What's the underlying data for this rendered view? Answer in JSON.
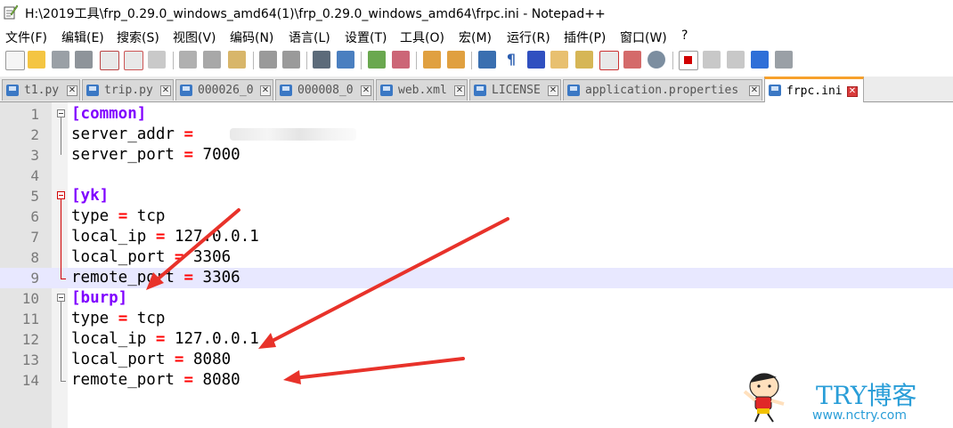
{
  "window": {
    "title": "H:\\2019工具\\frp_0.29.0_windows_amd64(1)\\frp_0.29.0_windows_amd64\\frpc.ini - Notepad++"
  },
  "menu": [
    "文件(F)",
    "编辑(E)",
    "搜索(S)",
    "视图(V)",
    "编码(N)",
    "语言(L)",
    "设置(T)",
    "工具(O)",
    "宏(M)",
    "运行(R)",
    "插件(P)",
    "窗口(W)",
    "?"
  ],
  "toolbar": {
    "icons": [
      "new-file-icon",
      "open-file-icon",
      "save-icon",
      "save-all-icon",
      "close-icon",
      "close-all-icon",
      "print-icon",
      "cut-icon",
      "copy-icon",
      "paste-icon",
      "undo-icon",
      "redo-icon",
      "find-icon",
      "replace-icon",
      "zoom-in-icon",
      "zoom-out-icon",
      "sync-vertical-icon",
      "sync-horizontal-icon",
      "word-wrap-icon",
      "show-all-chars-icon",
      "indent-guide-icon",
      "user-lang-icon",
      "doc-map-icon",
      "function-list-icon",
      "folder-workspace-icon",
      "monitor-icon",
      "record-macro-icon",
      "stop-record-icon",
      "play-macro-icon",
      "run-macro-multiple-icon",
      "save-macro-icon"
    ]
  },
  "tabs": [
    {
      "label": "t1.py",
      "active": false
    },
    {
      "label": "trip.py",
      "active": false
    },
    {
      "label": "000026_0",
      "active": false
    },
    {
      "label": "000008_0",
      "active": false
    },
    {
      "label": "web.xml",
      "active": false
    },
    {
      "label": "LICENSE",
      "active": false
    },
    {
      "label": "application.properties",
      "active": false
    },
    {
      "label": "frpc.ini",
      "active": true
    }
  ],
  "editor": {
    "current_line": 9,
    "lines": [
      {
        "n": "1",
        "key": "[common]",
        "eq": "",
        "val": ""
      },
      {
        "n": "2",
        "key": "server_addr",
        "eq": "=",
        "val": ""
      },
      {
        "n": "3",
        "key": "server_port",
        "eq": "=",
        "val": "7000"
      },
      {
        "n": "4",
        "key": "",
        "eq": "",
        "val": ""
      },
      {
        "n": "5",
        "key": "[yk]",
        "eq": "",
        "val": ""
      },
      {
        "n": "6",
        "key": "type",
        "eq": "=",
        "val": "tcp"
      },
      {
        "n": "7",
        "key": "local_ip",
        "eq": "=",
        "val": "127.0.0.1"
      },
      {
        "n": "8",
        "key": "local_port",
        "eq": "=",
        "val": "3306"
      },
      {
        "n": "9",
        "key": "remote_port",
        "eq": "=",
        "val": "3306"
      },
      {
        "n": "10",
        "key": "[burp]",
        "eq": "",
        "val": ""
      },
      {
        "n": "11",
        "key": "type",
        "eq": "=",
        "val": "tcp"
      },
      {
        "n": "12",
        "key": "local_ip",
        "eq": "=",
        "val": "127.0.0.1"
      },
      {
        "n": "13",
        "key": "local_port",
        "eq": "=",
        "val": "8080"
      },
      {
        "n": "14",
        "key": "remote_port",
        "eq": "=",
        "val": "8080"
      }
    ]
  },
  "watermark": {
    "text": "TRY博客",
    "url": "www.nctry.com"
  },
  "colors": {
    "section": "#8000ff",
    "operator": "#ff0000",
    "active_tab_accent": "#f7a12c",
    "annotation_arrow": "#e8322a",
    "watermark": "#2a9ed8"
  }
}
